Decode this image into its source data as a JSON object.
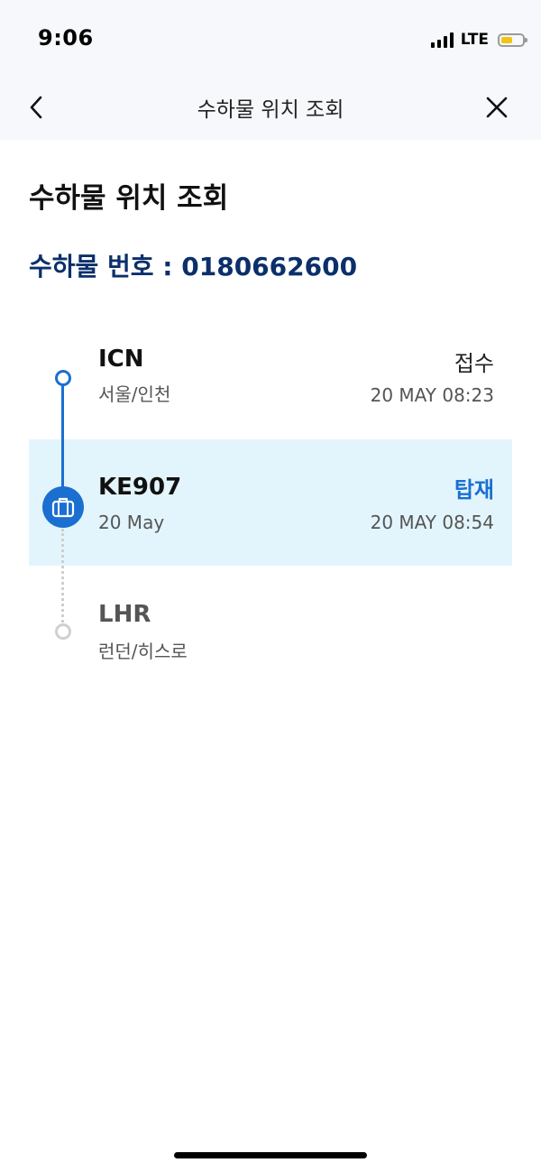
{
  "status_bar": {
    "time": "9:06",
    "network": "LTE",
    "battery_color": "#f2c316",
    "battery_level": 0.55
  },
  "header": {
    "title": "수하물 위치 조회",
    "back_icon": "chevron-left-icon",
    "close_icon": "close-icon"
  },
  "page": {
    "title": "수하물 위치 조회",
    "bag_number_label": "수하물 번호 : 0180662600"
  },
  "timeline": [
    {
      "code": "ICN",
      "sub": "서울/인천",
      "status": "접수",
      "time": "20 MAY 08:23"
    },
    {
      "code": "KE907",
      "sub": "20 May",
      "status": "탑재",
      "time": "20 MAY 08:54"
    },
    {
      "code": "LHR",
      "sub": "런던/히스로",
      "status": "",
      "time": ""
    }
  ],
  "colors": {
    "accent": "#1a6fd1",
    "bag_number": "#0b2f6b",
    "active_row_bg": "#e3f5fc",
    "inactive_text": "#555555"
  }
}
